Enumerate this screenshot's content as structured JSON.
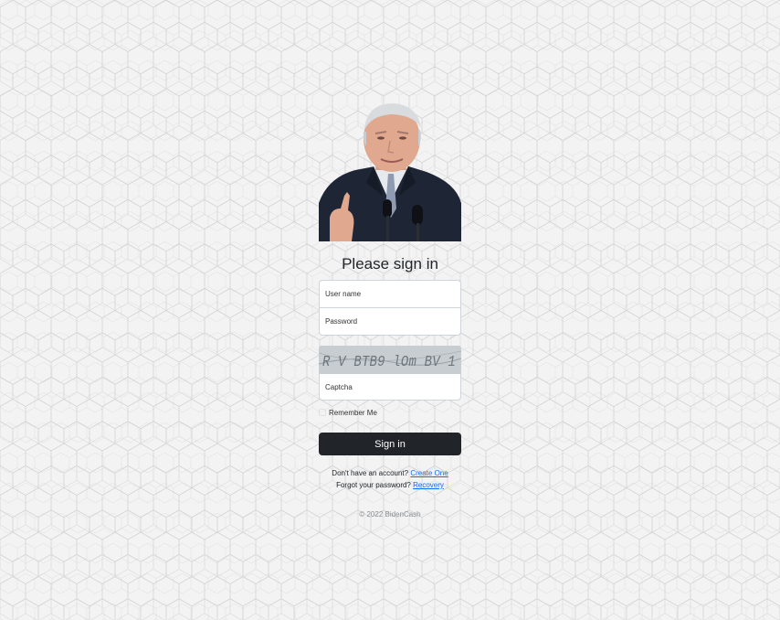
{
  "login": {
    "heading": "Please sign in",
    "username_placeholder": "User name",
    "password_placeholder": "Password",
    "captcha_text": "R V BTB9 lOm BV 1",
    "captcha_placeholder": "Captcha",
    "remember_label": "Remember Me",
    "submit_label": "Sign in"
  },
  "links": {
    "signup_prompt": "Don't have an account?",
    "signup_link": "Create One",
    "recovery_prompt": "Forgot your password?",
    "recovery_link": "Recovery"
  },
  "footer": {
    "copyright": "© 2022 BidenCash"
  },
  "colors": {
    "page_background": "#f1f1f1",
    "button": "#212529",
    "link": "#0d6efd"
  }
}
